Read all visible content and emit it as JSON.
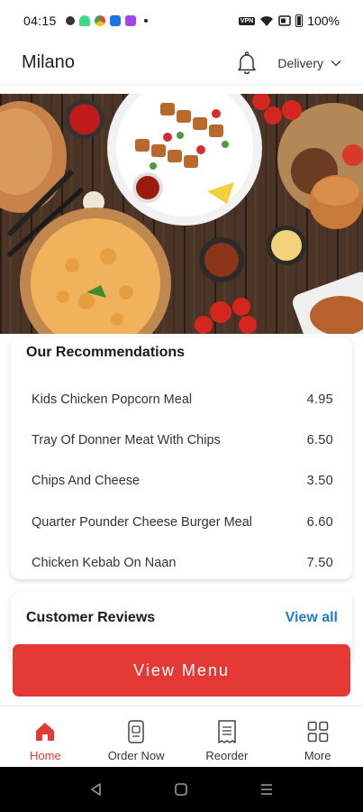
{
  "status_bar": {
    "time": "04:15",
    "vpn": "VPN",
    "battery": "100%"
  },
  "header": {
    "title": "Milano",
    "mode_label": "Delivery"
  },
  "recommendations": {
    "title": "Our Recommendations",
    "items": [
      {
        "name": "Kids Chicken Popcorn Meal",
        "price": "4.95"
      },
      {
        "name": "Tray Of Donner Meat With Chips",
        "price": "6.50"
      },
      {
        "name": "Chips And Cheese",
        "price": "3.50"
      },
      {
        "name": "Quarter Pounder Cheese Burger Meal",
        "price": "6.60"
      },
      {
        "name": "Chicken Kebab On Naan",
        "price": "7.50"
      }
    ]
  },
  "reviews": {
    "title": "Customer Reviews",
    "view_all": "View all"
  },
  "cta": {
    "label": "View Menu"
  },
  "bottom_nav": {
    "items": [
      {
        "label": "Home",
        "icon": "home-icon",
        "active": true
      },
      {
        "label": "Order Now",
        "icon": "order-phone-icon",
        "active": false
      },
      {
        "label": "Reorder",
        "icon": "receipt-icon",
        "active": false
      },
      {
        "label": "More",
        "icon": "grid-icon",
        "active": false
      }
    ]
  },
  "colors": {
    "accent": "#e53935",
    "link": "#1f7fc4",
    "hero_wood": "#3b2a1f"
  }
}
